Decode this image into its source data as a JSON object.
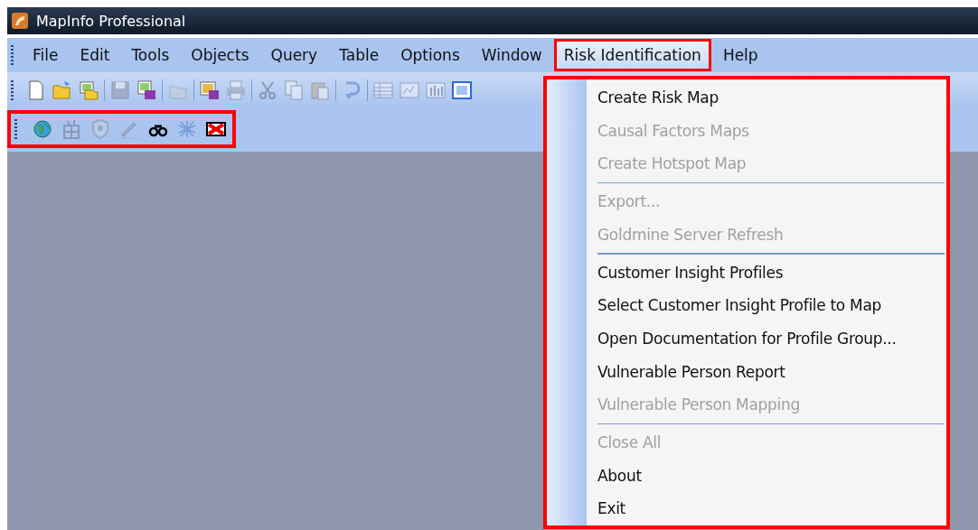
{
  "window": {
    "title": "MapInfo Professional"
  },
  "menu_bar": [
    {
      "label": "File",
      "selected": false,
      "highlighted": false
    },
    {
      "label": "Edit",
      "selected": false,
      "highlighted": false
    },
    {
      "label": "Tools",
      "selected": false,
      "highlighted": false
    },
    {
      "label": "Objects",
      "selected": false,
      "highlighted": false
    },
    {
      "label": "Query",
      "selected": false,
      "highlighted": false
    },
    {
      "label": "Table",
      "selected": false,
      "highlighted": false
    },
    {
      "label": "Options",
      "selected": false,
      "highlighted": false
    },
    {
      "label": "Window",
      "selected": false,
      "highlighted": false
    },
    {
      "label": "Risk Identification",
      "selected": true,
      "highlighted": true
    },
    {
      "label": "Help",
      "selected": false,
      "highlighted": false
    }
  ],
  "main_toolbar": [
    {
      "kind": "new",
      "disabled": false
    },
    {
      "kind": "open",
      "disabled": false
    },
    {
      "kind": "workspace",
      "disabled": false
    },
    {
      "kind": "separator"
    },
    {
      "kind": "save",
      "disabled": true
    },
    {
      "kind": "save-copy",
      "disabled": false
    },
    {
      "kind": "separator"
    },
    {
      "kind": "folder",
      "disabled": true
    },
    {
      "kind": "separator"
    },
    {
      "kind": "save-window",
      "disabled": false
    },
    {
      "kind": "print",
      "disabled": true
    },
    {
      "kind": "separator"
    },
    {
      "kind": "cut",
      "disabled": true
    },
    {
      "kind": "copy",
      "disabled": true
    },
    {
      "kind": "paste",
      "disabled": true
    },
    {
      "kind": "separator"
    },
    {
      "kind": "undo",
      "disabled": true
    },
    {
      "kind": "separator"
    },
    {
      "kind": "browser",
      "disabled": true
    },
    {
      "kind": "map",
      "disabled": true
    },
    {
      "kind": "graph",
      "disabled": true
    },
    {
      "kind": "layout",
      "disabled": false
    }
  ],
  "risk_toolbar": {
    "highlighted": true,
    "tools": [
      {
        "kind": "globe",
        "disabled": false
      },
      {
        "kind": "building",
        "disabled": true
      },
      {
        "kind": "shield",
        "disabled": true
      },
      {
        "kind": "pen",
        "disabled": true
      },
      {
        "kind": "binoculars",
        "disabled": false
      },
      {
        "kind": "network",
        "disabled": true
      },
      {
        "kind": "cross",
        "disabled": false
      }
    ]
  },
  "dropdown": {
    "highlighted": true,
    "groups": [
      [
        {
          "label": "Create Risk Map",
          "disabled": false
        },
        {
          "label": "Causal Factors Maps",
          "disabled": true
        },
        {
          "label": "Create Hotspot Map",
          "disabled": true
        }
      ],
      [
        {
          "label": "Export...",
          "disabled": true
        },
        {
          "label": "Goldmine Server Refresh",
          "disabled": true
        }
      ],
      [
        {
          "label": "Customer Insight Profiles",
          "disabled": false
        },
        {
          "label": "Select Customer Insight Profile to Map",
          "disabled": false
        },
        {
          "label": "Open Documentation for Profile Group...",
          "disabled": false
        },
        {
          "label": "Vulnerable Person Report",
          "disabled": false
        },
        {
          "label": "Vulnerable Person Mapping",
          "disabled": true
        }
      ],
      [
        {
          "label": "Close All",
          "disabled": true
        },
        {
          "label": "About",
          "disabled": false
        },
        {
          "label": "Exit",
          "disabled": false
        }
      ]
    ]
  }
}
